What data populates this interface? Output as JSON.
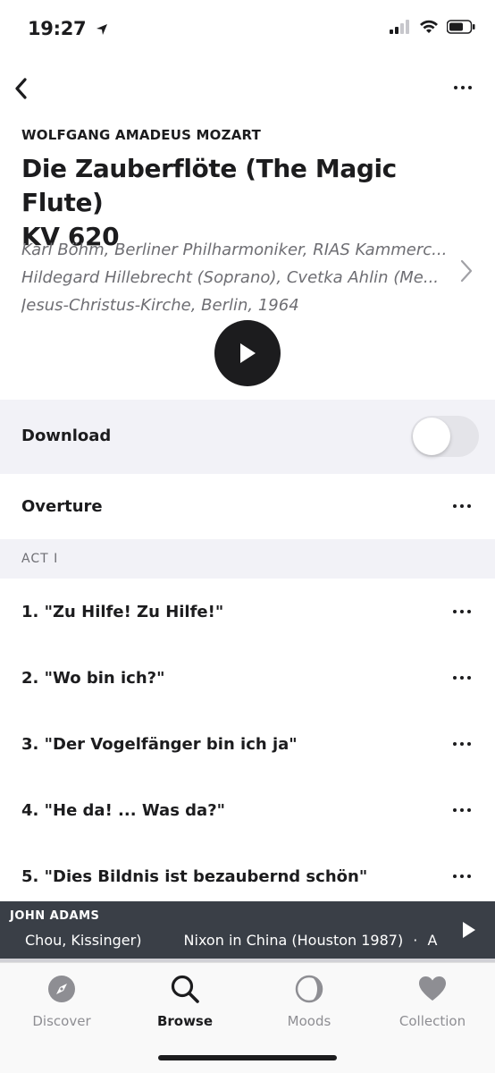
{
  "status_bar": {
    "time": "19:27"
  },
  "header": {
    "composer": "WOLFGANG AMADEUS MOZART",
    "title_line1": "Die Zauberflöte (The Magic Flute)",
    "title_line2": "KV 620"
  },
  "performers": {
    "line1": "Karl Böhm, Berliner Philharmoniker, RIAS Kammerc...",
    "line2": "Hildegard Hillebrecht (Soprano), Cvetka Ahlin (Me...",
    "line3": "Jesus-Christus-Kirche, Berlin, 1964"
  },
  "download": {
    "label": "Download",
    "enabled": false
  },
  "tracks_before": [
    {
      "title": "Overture"
    }
  ],
  "section": {
    "label": "ACT I"
  },
  "tracks": [
    {
      "title": "1. \"Zu Hilfe! Zu Hilfe!\""
    },
    {
      "title": "2. \"Wo bin ich?\""
    },
    {
      "title": "3. \"Der Vogelfänger bin ich ja\""
    },
    {
      "title": "4. \"He da! ... Was da?\""
    },
    {
      "title": "5. \"Dies Bildnis ist bezaubernd schön\""
    }
  ],
  "mini_player": {
    "artist": "JOHN ADAMS",
    "track_part1": "Chou, Kissinger)",
    "track_part2": "Nixon in China (Houston 1987)",
    "separator": "·",
    "track_part3": "Act I"
  },
  "tabs": [
    {
      "label": "Discover",
      "icon": "compass-icon",
      "active": false
    },
    {
      "label": "Browse",
      "icon": "search-icon",
      "active": true
    },
    {
      "label": "Moods",
      "icon": "moon-icon",
      "active": false
    },
    {
      "label": "Collection",
      "icon": "heart-icon",
      "active": false
    }
  ],
  "colors": {
    "text": "#1c1c1e",
    "secondary": "#6e6e73",
    "section_bg": "#f2f2f7",
    "player_bg": "#3a3f47"
  }
}
